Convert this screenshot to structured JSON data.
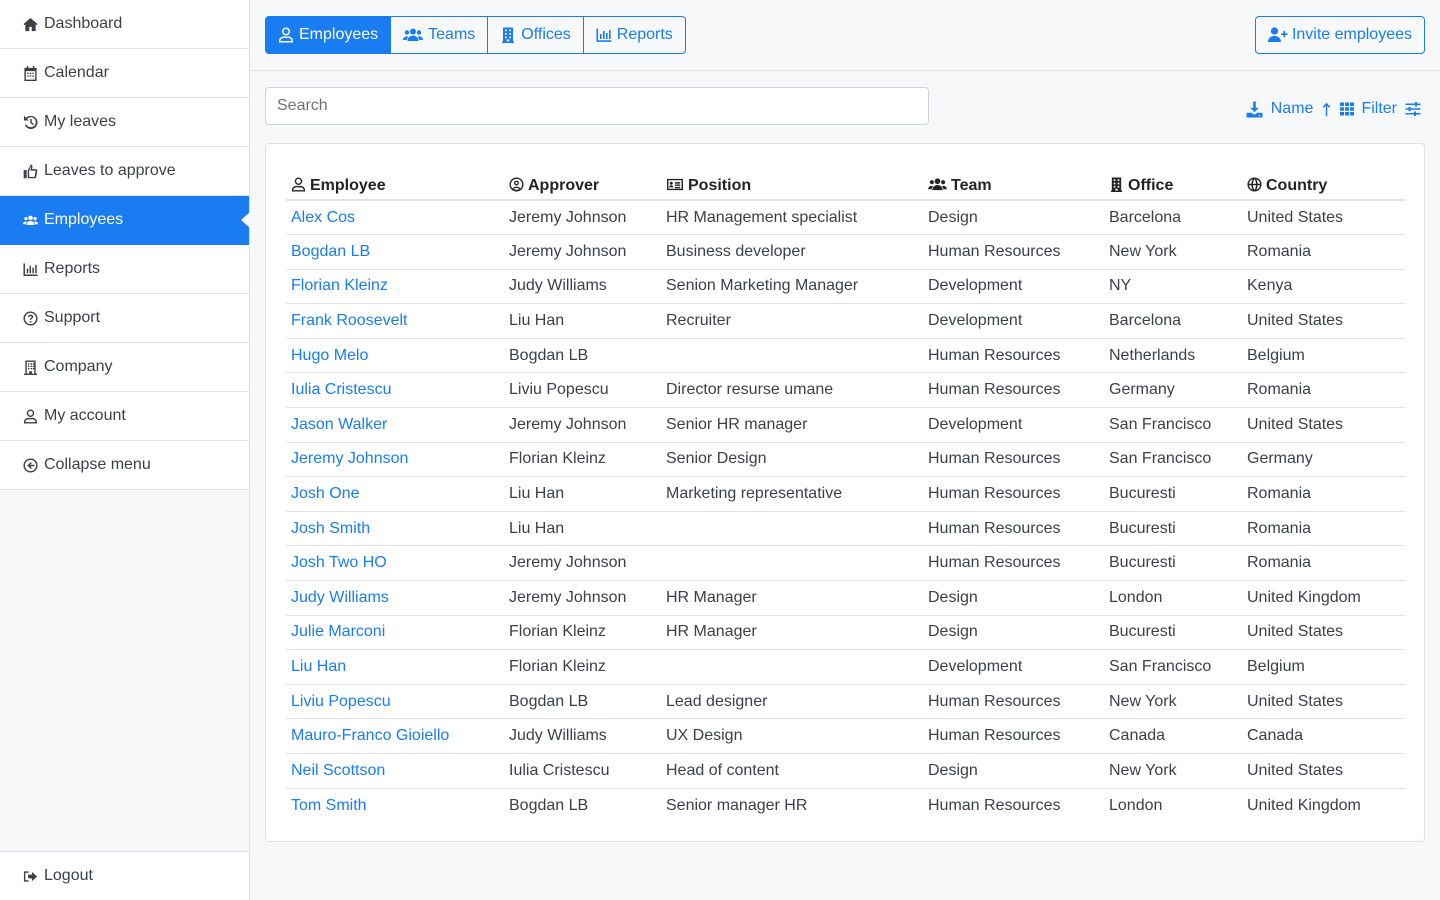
{
  "sidebar": {
    "items": [
      {
        "label": "Dashboard",
        "icon": "home-icon"
      },
      {
        "label": "Calendar",
        "icon": "calendar-icon"
      },
      {
        "label": "My leaves",
        "icon": "history-icon"
      },
      {
        "label": "Leaves to approve",
        "icon": "thumbs-up-icon"
      },
      {
        "label": "Employees",
        "icon": "users-icon",
        "active": true
      },
      {
        "label": "Reports",
        "icon": "chart-bar-icon"
      },
      {
        "label": "Support",
        "icon": "question-circle-icon"
      },
      {
        "label": "Company",
        "icon": "building-icon"
      },
      {
        "label": "My account",
        "icon": "user-icon"
      },
      {
        "label": "Collapse menu",
        "icon": "arrow-circle-left-icon"
      }
    ],
    "logout": {
      "label": "Logout",
      "icon": "sign-out-icon"
    }
  },
  "topbar": {
    "tabs": [
      {
        "label": "Employees",
        "active": true
      },
      {
        "label": "Teams"
      },
      {
        "label": "Offices"
      },
      {
        "label": "Reports"
      }
    ],
    "invite_label": "Invite employees"
  },
  "search": {
    "placeholder": "Search",
    "value": ""
  },
  "tools": {
    "sort_label": "Name",
    "filter_label": "Filter"
  },
  "colors": {
    "accent": "#1a7cf1",
    "text": "#3b4148",
    "border": "#dee2e6"
  },
  "table": {
    "headers": [
      "Employee",
      "Approver",
      "Position",
      "Team",
      "Office",
      "Country"
    ],
    "rows": [
      [
        "Alex Cos",
        "Jeremy Johnson",
        "HR Management specialist",
        "Design",
        "Barcelona",
        "United States"
      ],
      [
        "Bogdan LB",
        "Jeremy Johnson",
        "Business developer",
        "Human Resources",
        "New York",
        "Romania"
      ],
      [
        "Florian Kleinz",
        "Judy Williams",
        "Senion Marketing Manager",
        "Development",
        "NY",
        "Kenya"
      ],
      [
        "Frank Roosevelt",
        "Liu Han",
        "Recruiter",
        "Development",
        "Barcelona",
        "United States"
      ],
      [
        "Hugo Melo",
        "Bogdan LB",
        "",
        "Human Resources",
        "Netherlands",
        "Belgium"
      ],
      [
        "Iulia Cristescu",
        "Liviu Popescu",
        "Director resurse umane",
        "Human Resources",
        "Germany",
        "Romania"
      ],
      [
        "Jason Walker",
        "Jeremy Johnson",
        "Senior HR manager",
        "Development",
        "San Francisco",
        "United States"
      ],
      [
        "Jeremy Johnson",
        "Florian Kleinz",
        "Senior Design",
        "Human Resources",
        "San Francisco",
        "Germany"
      ],
      [
        "Josh One",
        "Liu Han",
        "Marketing representative",
        "Human Resources",
        "Bucuresti",
        "Romania"
      ],
      [
        "Josh Smith",
        "Liu Han",
        "",
        "Human Resources",
        "Bucuresti",
        "Romania"
      ],
      [
        "Josh Two HO",
        "Jeremy Johnson",
        "",
        "Human Resources",
        "Bucuresti",
        "Romania"
      ],
      [
        "Judy Williams",
        "Jeremy Johnson",
        "HR Manager",
        "Design",
        "London",
        "United Kingdom"
      ],
      [
        "Julie Marconi",
        "Florian Kleinz",
        "HR Manager",
        "Design",
        "Bucuresti",
        "United States"
      ],
      [
        "Liu Han",
        "Florian Kleinz",
        "",
        "Development",
        "San Francisco",
        "Belgium"
      ],
      [
        "Liviu Popescu",
        "Bogdan LB",
        "Lead designer",
        "Human Resources",
        "New York",
        "United States"
      ],
      [
        "Mauro-Franco Gioiello",
        "Judy Williams",
        "UX Design",
        "Human Resources",
        "Canada",
        "Canada"
      ],
      [
        "Neil Scottson",
        "Iulia Cristescu",
        "Head of content",
        "Design",
        "New York",
        "United States"
      ],
      [
        "Tom Smith",
        "Bogdan LB",
        "Senior manager HR",
        "Human Resources",
        "London",
        "United Kingdom"
      ]
    ]
  }
}
